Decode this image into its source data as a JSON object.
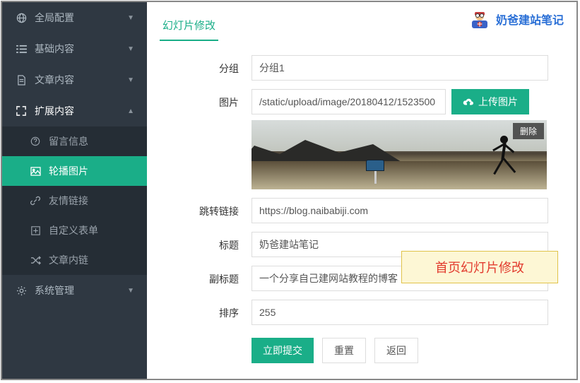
{
  "sidebar": {
    "items": [
      {
        "label": "全局配置",
        "icon": "globe"
      },
      {
        "label": "基础内容",
        "icon": "bars"
      },
      {
        "label": "文章内容",
        "icon": "file"
      },
      {
        "label": "扩展内容",
        "icon": "expand"
      },
      {
        "label": "系统管理",
        "icon": "gear"
      }
    ],
    "expand_sub": [
      {
        "label": "留言信息",
        "icon": "question"
      },
      {
        "label": "轮播图片",
        "icon": "image"
      },
      {
        "label": "友情链接",
        "icon": "link"
      },
      {
        "label": "自定义表单",
        "icon": "plus-square"
      },
      {
        "label": "文章内链",
        "icon": "shuffle"
      }
    ]
  },
  "tab_title": "幻灯片修改",
  "brand": "奶爸建站笔记",
  "form": {
    "group_label": "分组",
    "group_value": "分组1",
    "image_label": "图片",
    "image_value": "/static/upload/image/20180412/1523500",
    "upload_btn": "上传图片",
    "delete_btn": "删除",
    "link_label": "跳转链接",
    "link_value": "https://blog.naibabiji.com",
    "title_label": "标题",
    "title_value": "奶爸建站笔记",
    "subtitle_label": "副标题",
    "subtitle_value": "一个分享自己建网站教程的博客",
    "sort_label": "排序",
    "sort_value": "255",
    "submit": "立即提交",
    "reset": "重置",
    "back": "返回"
  },
  "callout": "首页幻灯片修改"
}
